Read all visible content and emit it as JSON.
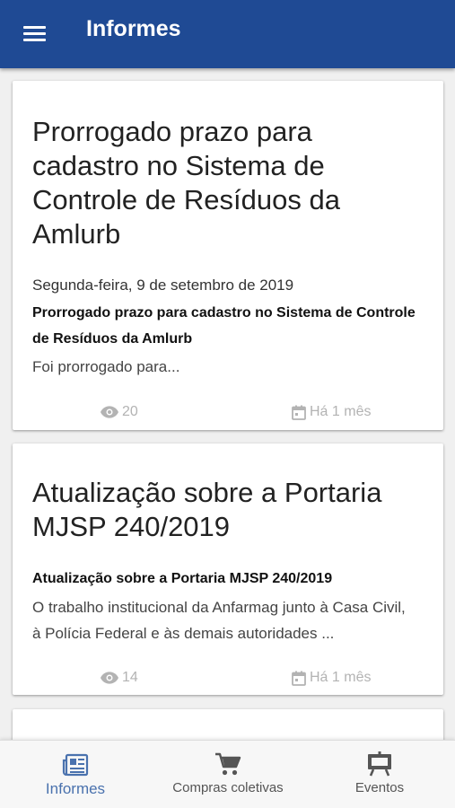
{
  "app": {
    "title": "Informes"
  },
  "feed": [
    {
      "title": "Prorrogado prazo para cadastro no Sistema de Controle de Resíduos da Amlurb",
      "date": "Segunda-feira, 9 de setembro de 2019",
      "subtitle": "Prorrogado prazo para cadastro no Sistema de Controle de Resíduos da Amlurb",
      "excerpt": "Foi prorrogado para...",
      "views": "20",
      "age": "Há 1 mês"
    },
    {
      "title": "Atualização sobre a Portaria MJSP 240/2019",
      "date": "",
      "subtitle": "Atualização sobre a Portaria MJSP 240/2019",
      "excerpt": "O trabalho institucional da Anfarmag junto à Casa Civil, à Polícia Federal e às demais autoridades ...",
      "views": "14",
      "age": "Há 1 mês"
    }
  ],
  "bottom_nav": [
    {
      "label": "Informes",
      "icon": "newspaper-icon",
      "active": true
    },
    {
      "label": "Compras coletivas",
      "icon": "cart-icon",
      "active": false
    },
    {
      "label": "Eventos",
      "icon": "easel-icon",
      "active": false
    }
  ],
  "colors": {
    "appbar": "#1f4a94",
    "active_nav": "#4a72ae",
    "meta_gray": "#b3b3b3",
    "background": "#f0f0f0"
  }
}
